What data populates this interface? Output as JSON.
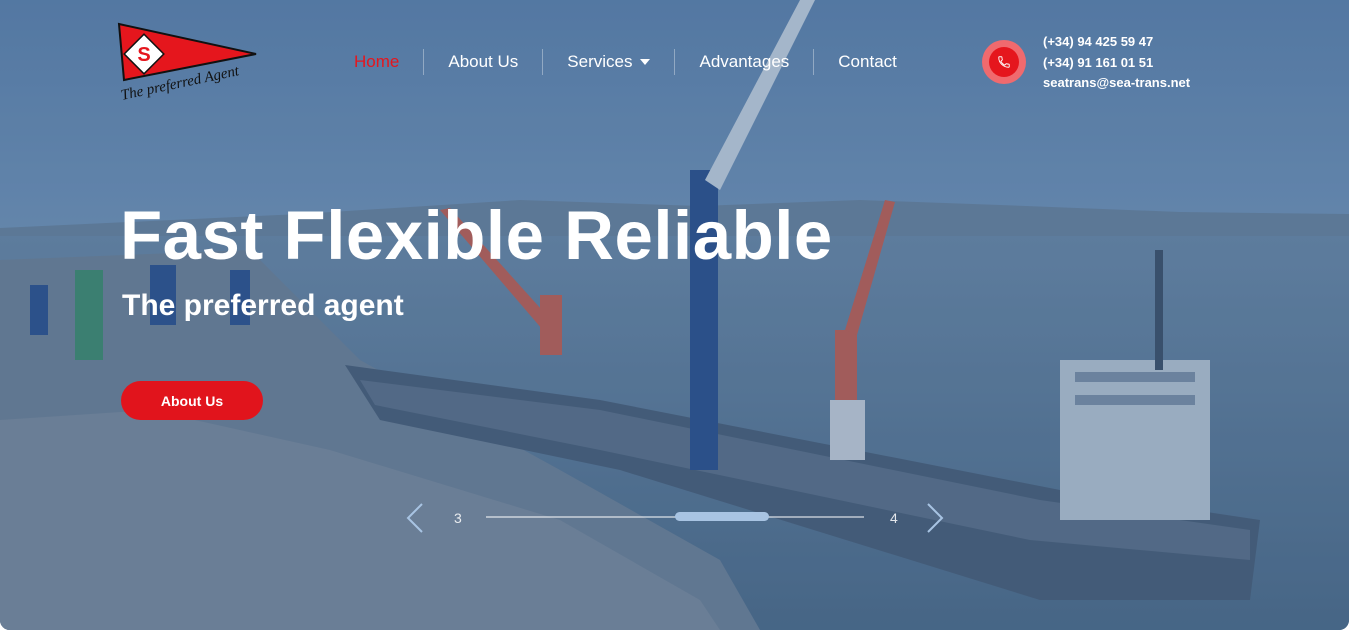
{
  "brand": {
    "logo_letter": "S",
    "logo_tagline": "The preferred Agent",
    "red": "#e5161d"
  },
  "nav": {
    "items": [
      {
        "label": "Home",
        "active": true
      },
      {
        "label": "About Us",
        "active": false
      },
      {
        "label": "Services",
        "active": false,
        "has_dropdown": true
      },
      {
        "label": "Advantages",
        "active": false
      },
      {
        "label": "Contact",
        "active": false
      }
    ]
  },
  "contact": {
    "icon": "phone-icon",
    "phone_1": "(+34) 94 425 59 47",
    "phone_2": "(+34) 91 161 01 51",
    "email": "seatrans@sea-trans.net"
  },
  "hero": {
    "title": "Fast Flexible Reliable",
    "subtitle": "The preferred agent",
    "cta_label": "About Us"
  },
  "slider": {
    "prev_icon": "chevron-left-icon",
    "next_icon": "chevron-right-icon",
    "prev_number": "3",
    "next_number": "4"
  }
}
